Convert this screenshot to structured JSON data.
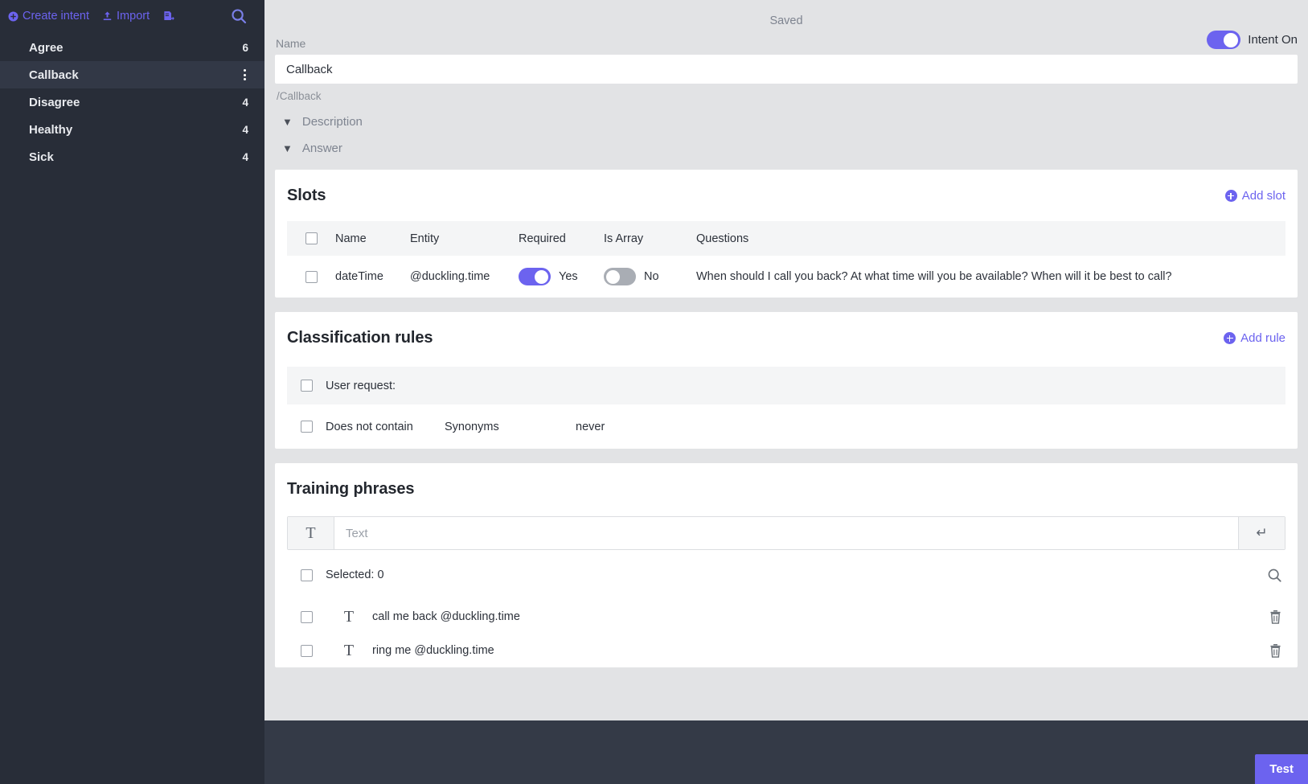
{
  "sidebar": {
    "toolbar": {
      "create_intent_label": "Create intent",
      "import_label": "Import",
      "export_icon": "file-export-icon",
      "search_icon": "search-icon"
    },
    "items": [
      {
        "label": "Agree",
        "count": "6",
        "active": false
      },
      {
        "label": "Callback",
        "count": "",
        "active": true
      },
      {
        "label": "Disagree",
        "count": "4",
        "active": false
      },
      {
        "label": "Healthy",
        "count": "4",
        "active": false
      },
      {
        "label": "Sick",
        "count": "4",
        "active": false
      }
    ]
  },
  "header": {
    "status": "Saved",
    "name_label": "Name",
    "name_value": "Callback",
    "name_placeholder": "Name",
    "path": "/Callback",
    "intent_toggle_label": "Intent On",
    "intent_toggle_on": true
  },
  "collapsers": [
    {
      "label": "Description"
    },
    {
      "label": "Answer"
    }
  ],
  "slots": {
    "title": "Slots",
    "add_label": "Add slot",
    "columns": [
      "Name",
      "Entity",
      "Required",
      "Is Array",
      "Questions"
    ],
    "rows": [
      {
        "name": "dateTime",
        "entity": "@duckling.time",
        "required_on": true,
        "required_label": "Yes",
        "is_array_on": false,
        "is_array_label": "No",
        "questions": "When should I call you back? At what time will you be available? When will it be best to call?"
      }
    ]
  },
  "classification_rules": {
    "title": "Classification rules",
    "add_label": "Add rule",
    "group_label": "User request:",
    "rows": [
      {
        "operator": "Does not contain",
        "type": "Synonyms",
        "value": "never"
      }
    ]
  },
  "training_phrases": {
    "title": "Training phrases",
    "input_placeholder": "Text",
    "input_value": "",
    "text_icon": "text-format-icon",
    "enter_icon": "enter-key-icon",
    "search_icon": "search-icon",
    "selected_label": "Selected: 0",
    "rows": [
      {
        "text": "call me back @duckling.time",
        "icon": "text-format-icon",
        "delete_icon": "trash-icon"
      },
      {
        "text": "ring me @duckling.time",
        "icon": "text-format-icon",
        "delete_icon": "trash-icon"
      }
    ]
  },
  "footer": {
    "test_label": "Test"
  },
  "colors": {
    "accent": "#6c63ef",
    "sidebar_bg": "#282d38",
    "sidebar_active": "#323846",
    "page_bg": "#e2e3e5",
    "footer_bg": "#343a47"
  }
}
